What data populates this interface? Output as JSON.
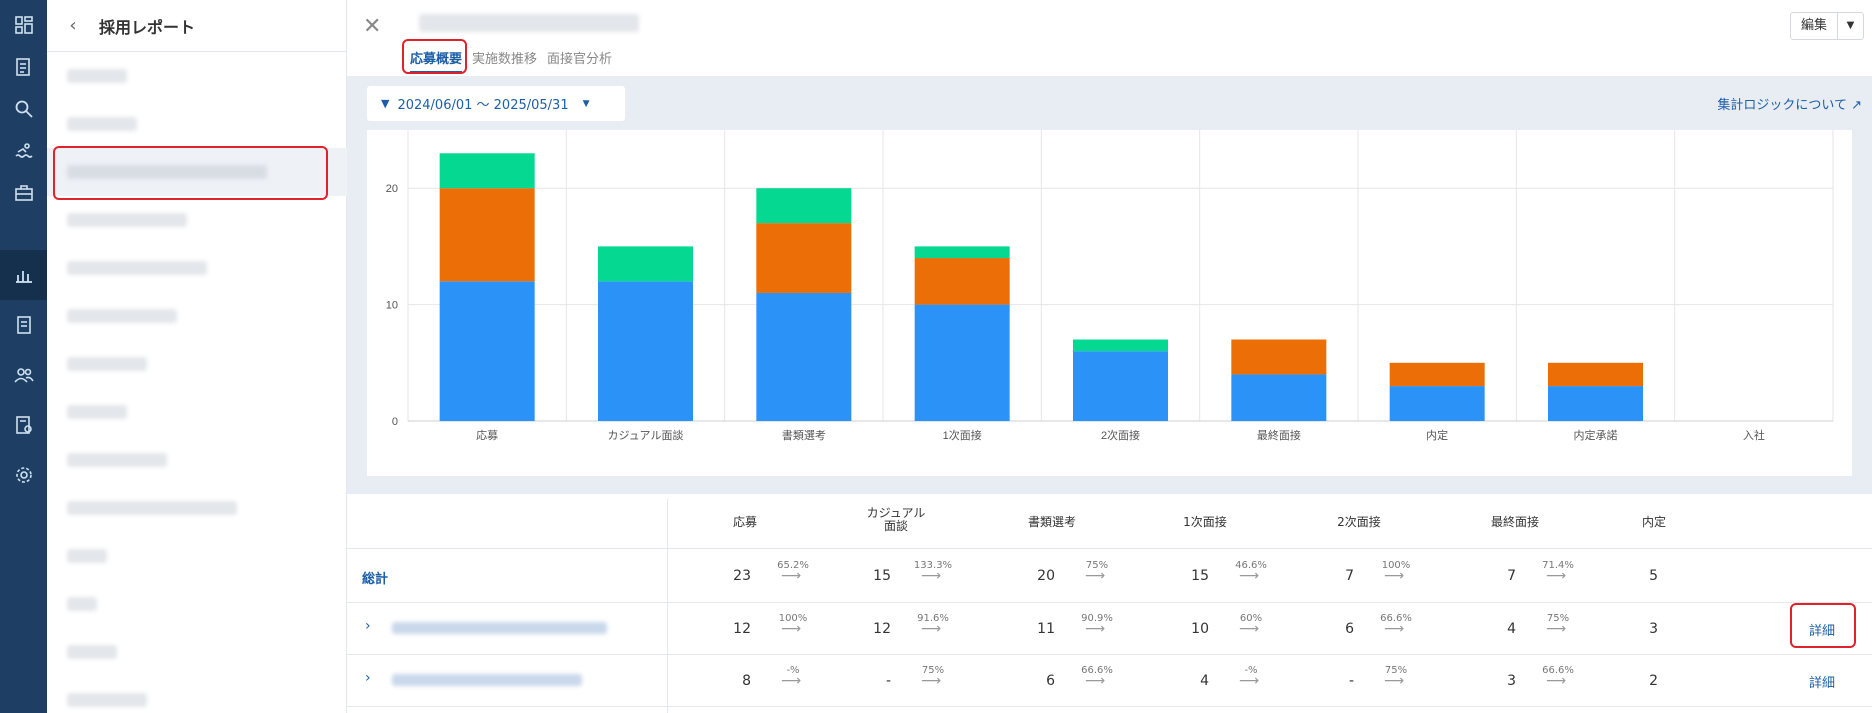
{
  "sidebar": {
    "title": "採用レポート",
    "items": [
      "",
      "",
      "",
      "",
      "",
      "",
      "",
      "",
      "",
      "",
      "",
      "",
      "",
      ""
    ]
  },
  "header": {
    "tabs": [
      "応募概要",
      "実施数推移",
      "面接官分析"
    ],
    "edit_label": "編集"
  },
  "filter": {
    "date_range": "2024/06/01 〜 2025/05/31",
    "logic_link": "集計ロジックについて"
  },
  "colors": {
    "blue": "#2b93f7",
    "orange": "#ec6e07",
    "green": "#05d891",
    "accent": "#1d5ea8",
    "highlight": "#e0232a"
  },
  "chart_data": {
    "type": "bar",
    "stacked": true,
    "categories": [
      "応募",
      "カジュアル面談",
      "書類選考",
      "1次面接",
      "2次面接",
      "最終面接",
      "内定",
      "内定承諾",
      "入社"
    ],
    "series": [
      {
        "values": [
          12,
          12,
          11,
          10,
          6,
          4,
          3,
          3,
          0
        ],
        "color": "#2b93f7"
      },
      {
        "values": [
          8,
          0,
          6,
          4,
          0,
          3,
          2,
          2,
          0
        ],
        "color": "#ec6e07"
      },
      {
        "values": [
          3,
          3,
          3,
          1,
          1,
          0,
          0,
          0,
          0
        ],
        "color": "#05d891"
      }
    ],
    "yticks": [
      0,
      10,
      20
    ],
    "ylim": [
      0,
      25
    ],
    "grid": true
  },
  "table": {
    "columns": [
      "応募",
      "カジュアル面談",
      "書類選考",
      "1次面接",
      "2次面接",
      "最終面接",
      "内定"
    ],
    "rows": [
      {
        "label": "総計",
        "values": [
          "23",
          "15",
          "20",
          "15",
          "7",
          "7",
          "5"
        ],
        "rates": [
          "65.2%",
          "133.3%",
          "75%",
          "46.6%",
          "100%",
          "71.4%"
        ],
        "detail": ""
      },
      {
        "label": "",
        "values": [
          "12",
          "12",
          "11",
          "10",
          "6",
          "4",
          "3"
        ],
        "rates": [
          "100%",
          "91.6%",
          "90.9%",
          "60%",
          "66.6%",
          "75%"
        ],
        "detail": "詳細"
      },
      {
        "label": "",
        "values": [
          "8",
          "-",
          "6",
          "4",
          "-",
          "3",
          "2"
        ],
        "rates": [
          "-%",
          "75%",
          "66.6%",
          "-%",
          "75%",
          "66.6%"
        ],
        "detail": "詳細"
      }
    ]
  }
}
